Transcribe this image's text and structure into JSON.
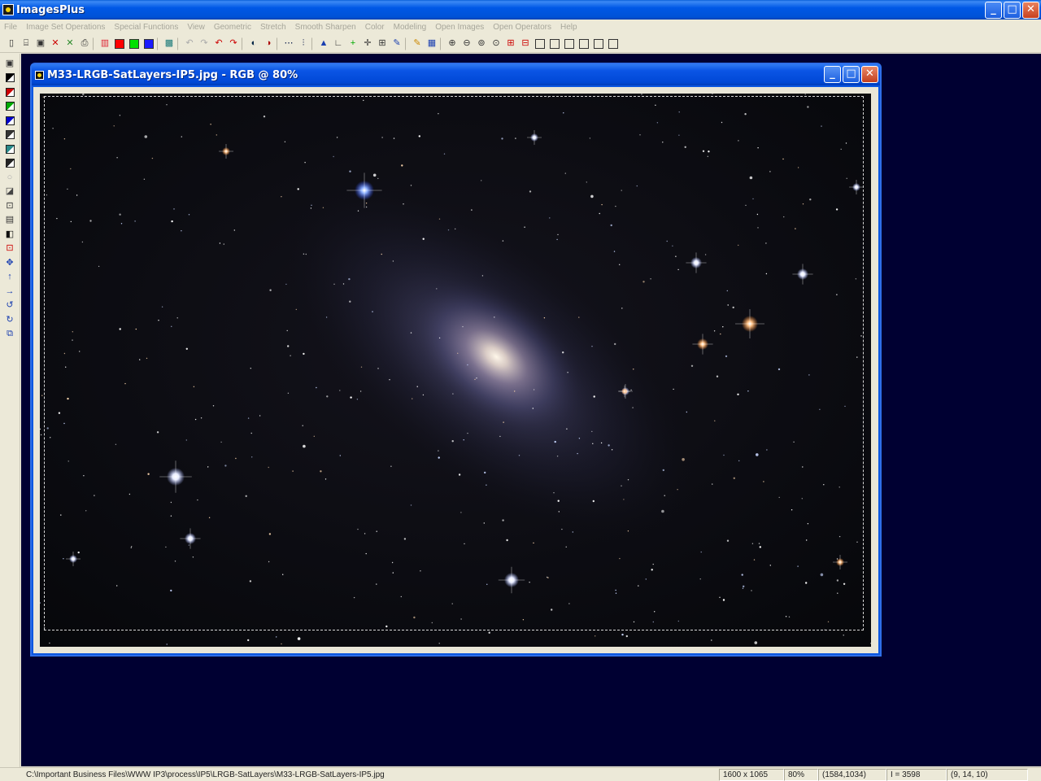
{
  "app": {
    "title": "ImagesPlus"
  },
  "menu": [
    "File",
    "Image Set Operations",
    "Special Functions",
    "View",
    "Geometric",
    "Stretch",
    "Smooth Sharpen",
    "Color",
    "Modeling",
    "Open Images",
    "Open Operators",
    "Help"
  ],
  "window_buttons": {
    "minimize": "_",
    "maximize": "□",
    "close": "✕"
  },
  "toolbar_icons": [
    {
      "name": "new-icon",
      "glyph": "▯"
    },
    {
      "name": "open-icon",
      "glyph": "⌸"
    },
    {
      "name": "save-icon",
      "glyph": "▣"
    },
    {
      "name": "close-image-icon",
      "glyph": "✕",
      "color": "#c00"
    },
    {
      "name": "close-all-icon",
      "glyph": "✕",
      "color": "#2a8a2a"
    },
    {
      "name": "print-icon",
      "glyph": "⎙"
    },
    {
      "name": "sep"
    },
    {
      "name": "channels-icon",
      "glyph": "▥",
      "color": "#d23"
    },
    {
      "name": "red-channel-icon",
      "swatch": "#ff0000"
    },
    {
      "name": "green-channel-icon",
      "swatch": "#00e000"
    },
    {
      "name": "blue-channel-icon",
      "swatch": "#1a1aff"
    },
    {
      "name": "sep"
    },
    {
      "name": "image-info-icon",
      "glyph": "▩",
      "color": "#1a7a7a"
    },
    {
      "name": "sep"
    },
    {
      "name": "undo-icon",
      "glyph": "↶",
      "color": "#aaa"
    },
    {
      "name": "redo-icon",
      "glyph": "↷",
      "color": "#aaa"
    },
    {
      "name": "undo-red-icon",
      "glyph": "↶",
      "color": "#c00"
    },
    {
      "name": "redo-red-icon",
      "glyph": "↷",
      "color": "#c00"
    },
    {
      "name": "sep"
    },
    {
      "name": "black-point-icon",
      "glyph": "◐",
      "color": "#024"
    },
    {
      "name": "white-point-icon",
      "glyph": "◑",
      "color": "#a00"
    },
    {
      "name": "sep"
    },
    {
      "name": "line-profile-icon",
      "glyph": "⋯",
      "color": "#014"
    },
    {
      "name": "histogram-icon",
      "glyph": "⫶",
      "color": "#014"
    },
    {
      "name": "sep"
    },
    {
      "name": "star-icon",
      "glyph": "▲",
      "color": "#1a3fb0"
    },
    {
      "name": "measure-icon",
      "glyph": "∟",
      "color": "#333"
    },
    {
      "name": "crosshair-icon",
      "glyph": "+",
      "color": "#0a0"
    },
    {
      "name": "move-cross-icon",
      "glyph": "✛",
      "color": "#333"
    },
    {
      "name": "grid-icon",
      "glyph": "⊞",
      "color": "#333"
    },
    {
      "name": "paint-icon",
      "glyph": "✎",
      "color": "#1a3fb0"
    },
    {
      "name": "sep"
    },
    {
      "name": "pencil-icon",
      "glyph": "✎",
      "color": "#c80"
    },
    {
      "name": "mosaic-icon",
      "glyph": "▦",
      "color": "#1a3fb0"
    },
    {
      "name": "sep"
    },
    {
      "name": "zoom-in-icon",
      "glyph": "⊕"
    },
    {
      "name": "zoom-out-icon",
      "glyph": "⊖"
    },
    {
      "name": "zoom-fit-icon",
      "glyph": "⊚"
    },
    {
      "name": "zoom-actual-icon",
      "glyph": "⊙"
    },
    {
      "name": "plus-box-icon",
      "glyph": "⊞",
      "color": "#c00"
    },
    {
      "name": "minus-box-icon",
      "glyph": "⊟",
      "color": "#c00"
    },
    {
      "name": "frame1-icon",
      "square": true
    },
    {
      "name": "frame2-icon",
      "square": true
    },
    {
      "name": "frame3-icon",
      "square": true
    },
    {
      "name": "frame4-icon",
      "square": true
    },
    {
      "name": "frame5-icon",
      "square": true
    },
    {
      "name": "frame6-icon",
      "square": true
    }
  ],
  "left_tools": [
    {
      "name": "save-tool-icon",
      "glyph": "▣",
      "color": "#333"
    },
    {
      "name": "black-swatch-icon",
      "square": "#000"
    },
    {
      "name": "red-swatch-icon",
      "square": "#c00"
    },
    {
      "name": "green-swatch-icon",
      "square": "#0a0"
    },
    {
      "name": "blue-swatch-icon",
      "square": "#00c"
    },
    {
      "name": "color-combine-icon",
      "square": "#333"
    },
    {
      "name": "color-split-icon",
      "square": "#2a8a8a"
    },
    {
      "name": "mask-icon",
      "square": "#222"
    },
    {
      "name": "light-icon",
      "glyph": "○",
      "color": "#aaa"
    },
    {
      "name": "gradient-icon",
      "glyph": "◪",
      "color": "#444"
    },
    {
      "name": "box-icon",
      "glyph": "⊡",
      "color": "#333"
    },
    {
      "name": "align-icon",
      "glyph": "▤",
      "color": "#333"
    },
    {
      "name": "half-icon",
      "glyph": "◧",
      "color": "#111"
    },
    {
      "name": "select-icon",
      "glyph": "⊡",
      "color": "#c00"
    },
    {
      "name": "move-icon",
      "glyph": "✥",
      "color": "#1a3fb0"
    },
    {
      "name": "up-arrow-icon",
      "glyph": "↑",
      "color": "#1a3fb0"
    },
    {
      "name": "right-arrow-icon",
      "glyph": "→",
      "color": "#1a3fb0"
    },
    {
      "name": "rotate-left-icon",
      "glyph": "↺",
      "color": "#1a3fb0"
    },
    {
      "name": "rotate-right-icon",
      "glyph": "↻",
      "color": "#1a3fb0"
    },
    {
      "name": "flip-icon",
      "glyph": "⧉",
      "color": "#1a3fb0"
    }
  ],
  "image_window": {
    "title": "M33-LRGB-SatLayers-IP5.jpg - RGB @ 80%"
  },
  "status": {
    "path": "C:\\Important Business Files\\WWW IP3\\process\\IP5\\LRGB-SatLayers\\M33-LRGB-SatLayers-IP5.jpg",
    "dimensions": "1600 x 1065",
    "zoom": "80%",
    "coords": "(1584,1034)",
    "intensity": "I = 3598",
    "rgb": "(9, 14, 10)"
  },
  "colors": {
    "workspace": "#000032",
    "title_blue": "#0058e6",
    "menu_disabled": "#a7a69a"
  }
}
